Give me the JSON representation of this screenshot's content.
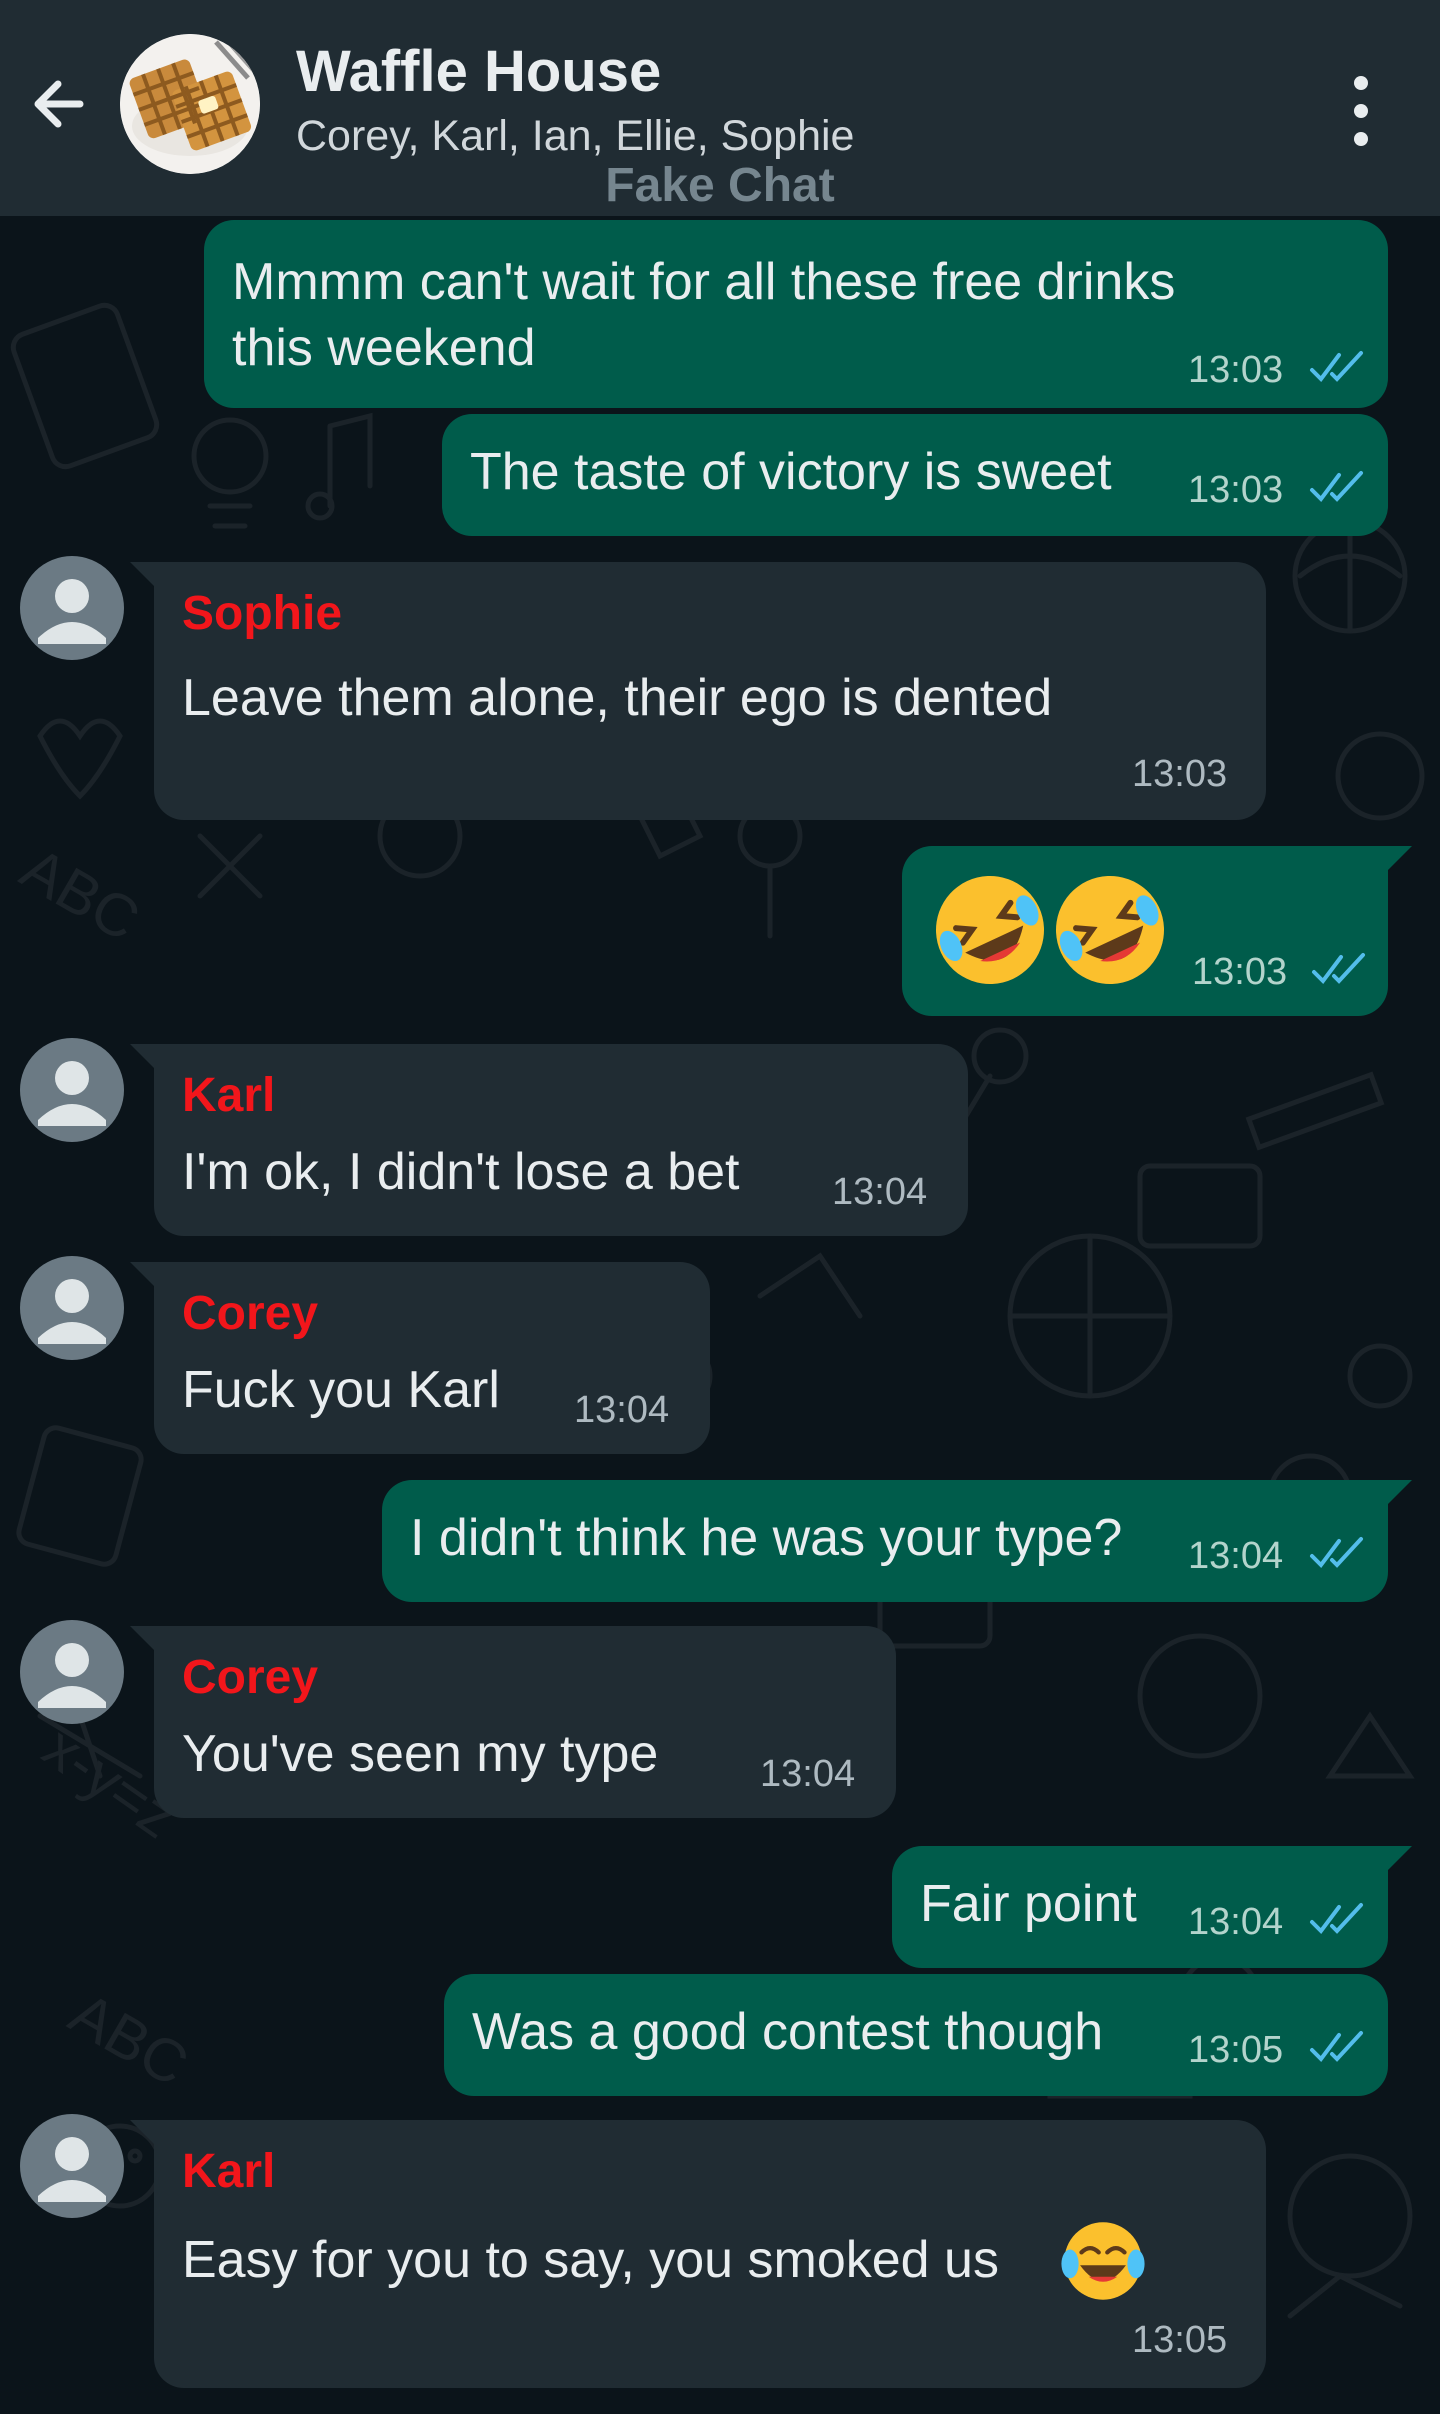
{
  "header": {
    "title": "Waffle House",
    "subtitle": "Corey, Karl, Ian, Ellie, Sophie",
    "watermark": "Fake Chat",
    "group_icon": "waffle-group-avatar",
    "back_icon": "arrow-left-icon",
    "menu_icon": "more-vertical-icon"
  },
  "colors": {
    "header_bg": "#202c33",
    "chat_bg": "#0b141a",
    "outgoing_bubble": "#005c4b",
    "incoming_bubble": "#202c33",
    "sender_name": "#f2161b",
    "read_ticks": "#53bdeb"
  },
  "messages": [
    {
      "direction": "out",
      "text_line1": "Mmmm can't wait for all these free drinks",
      "text_line2": "this weekend",
      "time": "13:03",
      "status": "read"
    },
    {
      "direction": "out",
      "text": "The taste of victory is sweet",
      "time": "13:03",
      "status": "read"
    },
    {
      "direction": "in",
      "sender": "Sophie",
      "text": "Leave them alone, their ego is dented",
      "time": "13:03"
    },
    {
      "direction": "out",
      "text": "🤣🤣",
      "emoji": "rolling-on-floor-laughing",
      "time": "13:03",
      "status": "read"
    },
    {
      "direction": "in",
      "sender": "Karl",
      "text": "I'm ok, I didn't lose a bet",
      "time": "13:04"
    },
    {
      "direction": "in",
      "sender": "Corey",
      "text": "Fuck you Karl",
      "time": "13:04"
    },
    {
      "direction": "out",
      "text": "I didn't think he was your type?",
      "time": "13:04",
      "status": "read"
    },
    {
      "direction": "in",
      "sender": "Corey",
      "text": "You've seen my type",
      "time": "13:04"
    },
    {
      "direction": "out",
      "text": "Fair point",
      "time": "13:04",
      "status": "read"
    },
    {
      "direction": "out",
      "text": "Was a good contest though",
      "time": "13:05",
      "status": "read"
    },
    {
      "direction": "in",
      "sender": "Karl",
      "text": "Easy for you to say, you smoked us",
      "emoji": "face-with-tears-of-joy",
      "time": "13:05"
    }
  ]
}
